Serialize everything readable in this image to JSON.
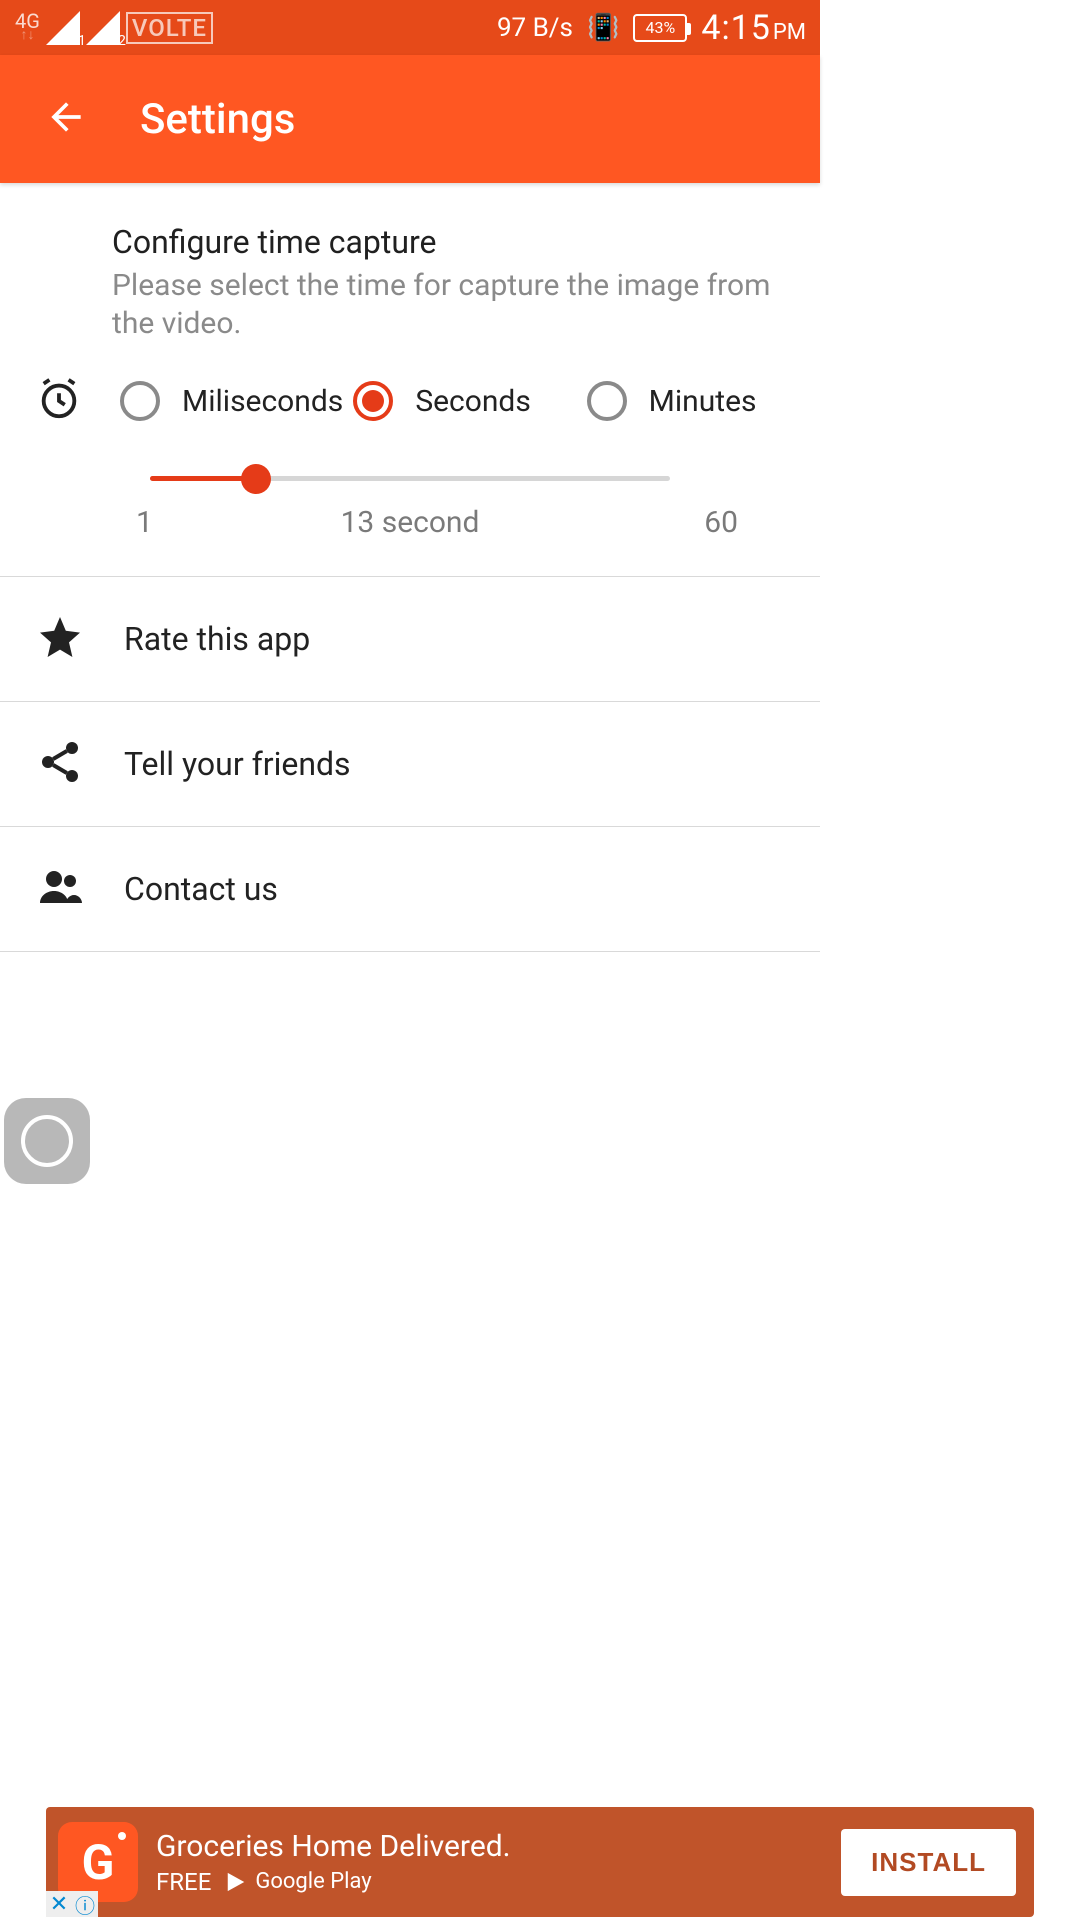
{
  "status": {
    "network": "4G",
    "signal1_sub": "1",
    "signal2_sub": "2",
    "volte": "VOLTE",
    "data_rate": "97 B/s",
    "battery": "43%",
    "time": "4:15",
    "ampm": "PM"
  },
  "appbar": {
    "title": "Settings"
  },
  "config": {
    "title": "Configure time capture",
    "subtitle": "Please select the time for capture the image from the video.",
    "radios": {
      "ms": "Miliseconds",
      "s": "Seconds",
      "m": "Minutes"
    },
    "selected": "s",
    "slider": {
      "min": "1",
      "max": "60",
      "current_label": "13 second",
      "percent": 20.3
    }
  },
  "menu": {
    "rate": "Rate this app",
    "share": "Tell your friends",
    "contact": "Contact us"
  },
  "ad": {
    "title": "Groceries Home Delivered.",
    "price": "FREE",
    "store": "Google Play",
    "cta": "INSTALL",
    "brand_letter": "G"
  }
}
